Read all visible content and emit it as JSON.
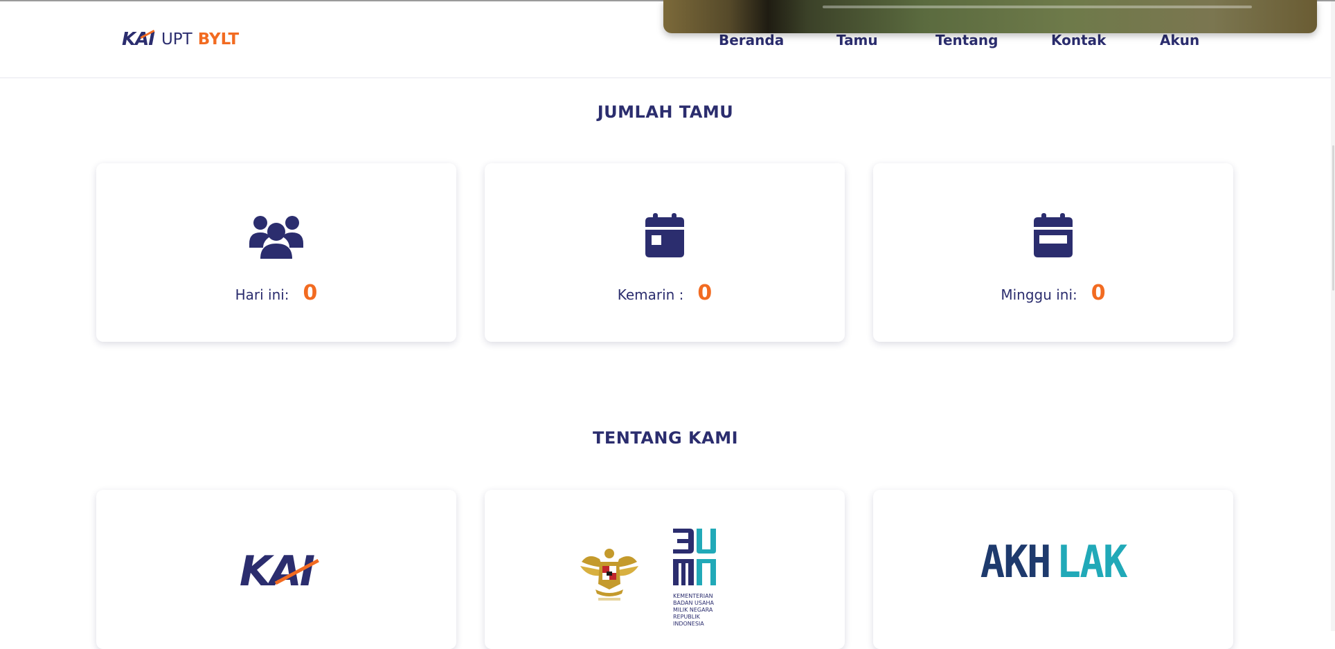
{
  "brand": {
    "kai": "KAI",
    "upt": "UPT",
    "bylt": "BYLT"
  },
  "nav": {
    "items": [
      {
        "label": "Beranda"
      },
      {
        "label": "Tamu"
      },
      {
        "label": "Tentang"
      },
      {
        "label": "Kontak"
      },
      {
        "label": "Akun"
      }
    ]
  },
  "guests": {
    "title": "JUMLAH TAMU",
    "cards": [
      {
        "icon": "users-icon",
        "label": "Hari ini:",
        "value": "0"
      },
      {
        "icon": "calendar-icon",
        "label": "Kemarin :",
        "value": "0"
      },
      {
        "icon": "calendar-week-icon",
        "label": "Minggu ini:",
        "value": "0"
      }
    ]
  },
  "about": {
    "title": "TENTANG KAMI",
    "logos": [
      {
        "name": "kai-logo",
        "text": "KAI"
      },
      {
        "name": "bumn-logo",
        "text": "BUMN",
        "subtitle": [
          "KEMENTERIAN",
          "BADAN USAHA",
          "MILIK NEGARA",
          "REPUBLIK",
          "INDONESIA"
        ]
      },
      {
        "name": "akhlak-logo",
        "text_dark": "AKH",
        "text_teal": "LAK"
      }
    ]
  },
  "colors": {
    "navy": "#2b2d6e",
    "orange": "#f26b21",
    "teal": "#21a9b8",
    "akhlak_navy": "#1e3a6d"
  }
}
